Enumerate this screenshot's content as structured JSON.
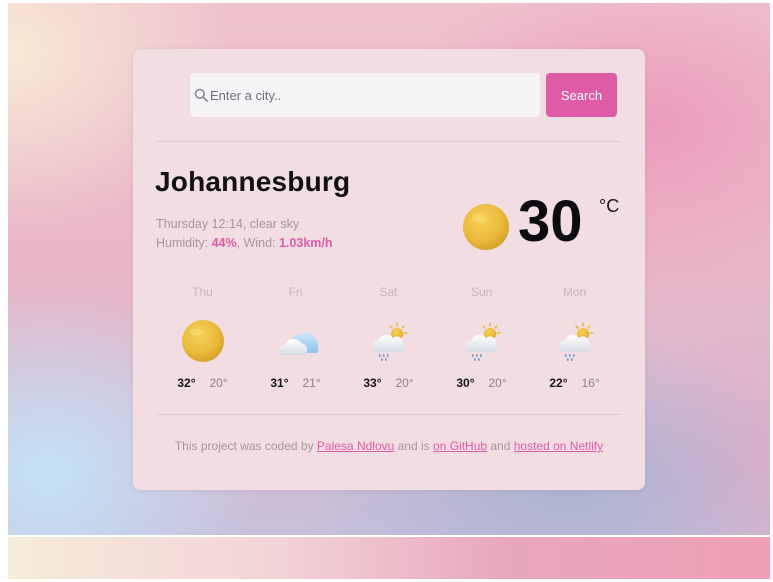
{
  "search": {
    "placeholder": "Enter a city..",
    "button_label": "Search"
  },
  "current": {
    "city": "Johannesburg",
    "date_desc": "Thursday 12:14, clear sky",
    "humidity_label": "Humidity: ",
    "humidity_value": "44%",
    "wind_label": ", Wind: ",
    "wind_value": "1.03km/h",
    "temperature": "30",
    "unit": "°C",
    "icon": "clear-sky-icon"
  },
  "forecast": [
    {
      "day": "Thu",
      "max": "32°",
      "min": "20°",
      "icon": "sun-icon"
    },
    {
      "day": "Fri",
      "max": "31°",
      "min": "21°",
      "icon": "cloud-icon"
    },
    {
      "day": "Sat",
      "max": "33°",
      "min": "20°",
      "icon": "sun-rain-icon"
    },
    {
      "day": "Sun",
      "max": "30°",
      "min": "20°",
      "icon": "sun-rain-icon"
    },
    {
      "day": "Mon",
      "max": "22°",
      "min": "16°",
      "icon": "sun-rain-icon"
    }
  ],
  "footer": {
    "text1": "This project was coded by ",
    "author": "Palesa Ndlovu",
    "text2": " and is ",
    "github": "on GitHub",
    "text3": " and ",
    "netlify": "hosted on Netlify"
  },
  "colors": {
    "accent": "#e05ba6",
    "card": "#f2dde2"
  }
}
